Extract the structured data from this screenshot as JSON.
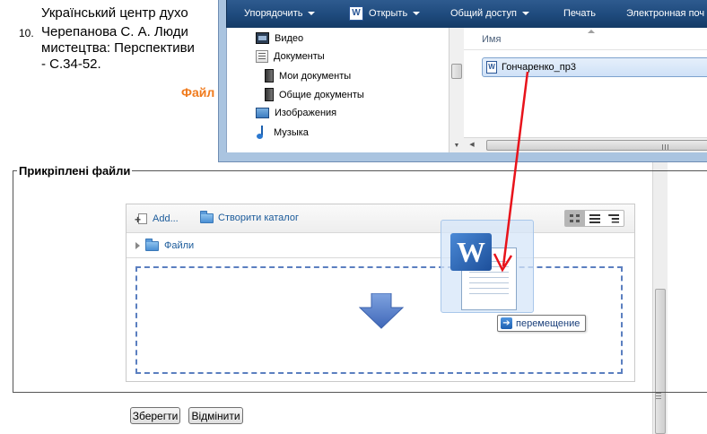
{
  "document": {
    "lines": [
      "Український центр духо",
      "Черепанова С. А. Люди",
      "мистецтва: Перспективи",
      "- С.34-52."
    ],
    "number": "10.",
    "section_title": "Файл"
  },
  "fieldset": {
    "legend": "Прикріплені файли"
  },
  "filemanager": {
    "add_label": "Add...",
    "create_folder_label": "Створити каталог",
    "path_label": "Файли",
    "view_modes": [
      "icons-view-icon",
      "list-view-icon",
      "tree-view-icon"
    ]
  },
  "drag": {
    "tooltip": "перемещение"
  },
  "buttons": {
    "save": "Зберегти",
    "cancel": "Відмінити"
  },
  "explorer": {
    "toolbar": {
      "organize": "Упорядочить",
      "open": "Открыть",
      "share": "Общий доступ",
      "print": "Печать",
      "email": "Электронная поч"
    },
    "nav": [
      "Видео",
      "Документы",
      "Мои документы",
      "Общие документы",
      "Изображения",
      "Музыка"
    ],
    "column_header": "Имя",
    "file_name": "Гончаренко_пр3"
  },
  "colors": {
    "accent_orange": "#f07a1b",
    "toolbar_blue": "#1e4a7c",
    "link_blue": "#1a5a9a",
    "drag_line_red": "#e8131b",
    "dropzone_dash": "#5b7fc0"
  }
}
